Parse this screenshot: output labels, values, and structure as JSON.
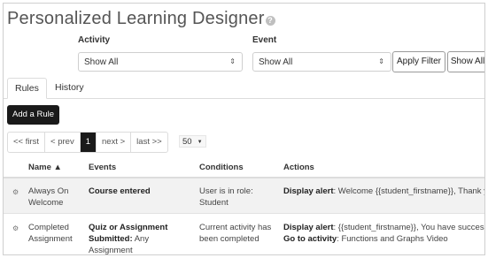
{
  "page": {
    "title": "Personalized Learning Designer"
  },
  "filters": {
    "activity_label": "Activity",
    "activity_value": "Show All",
    "event_label": "Event",
    "event_value": "Show All",
    "apply_button": "Apply Filter",
    "show_all_button": "Show All"
  },
  "tabs": [
    {
      "label": "Rules",
      "active": true
    },
    {
      "label": "History",
      "active": false
    }
  ],
  "add_rule_button": "Add a Rule",
  "pagination": {
    "first": "<< first",
    "prev": "< prev",
    "current": "1",
    "next": "next >",
    "last": "last >>",
    "per_page": "50"
  },
  "table": {
    "headers": {
      "name": "Name ▲",
      "events": "Events",
      "conditions": "Conditions",
      "actions": "Actions"
    },
    "rows": [
      {
        "name_line1": "Always On",
        "name_line2": "Welcome",
        "event_main": "Course entered",
        "event_rest": "",
        "event_line3": "",
        "condition_line1": "User is in role:",
        "condition_line2": "Student",
        "action1_label": "Display alert",
        "action1_text": ": Welcome {{student_firstname}}, Thank y...",
        "action2_label": "",
        "action2_text": ""
      },
      {
        "name_line1": "Completed",
        "name_line2": "Assignment",
        "event_main": "Quiz or Assignment",
        "event_rest_bold": "Submitted:",
        "event_rest": " Any",
        "event_line3": "Assignment",
        "condition_line1": "Current activity has",
        "condition_line2": "been completed",
        "action1_label": "Display alert",
        "action1_text": ": {{student_firstname}}, You have successf...",
        "action2_label": "Go to activity",
        "action2_text": ": Functions and Graphs Video"
      }
    ]
  },
  "icons": {
    "help": "help-icon",
    "row_settings": "gear-icon",
    "caret": "chevron-down-icon"
  }
}
